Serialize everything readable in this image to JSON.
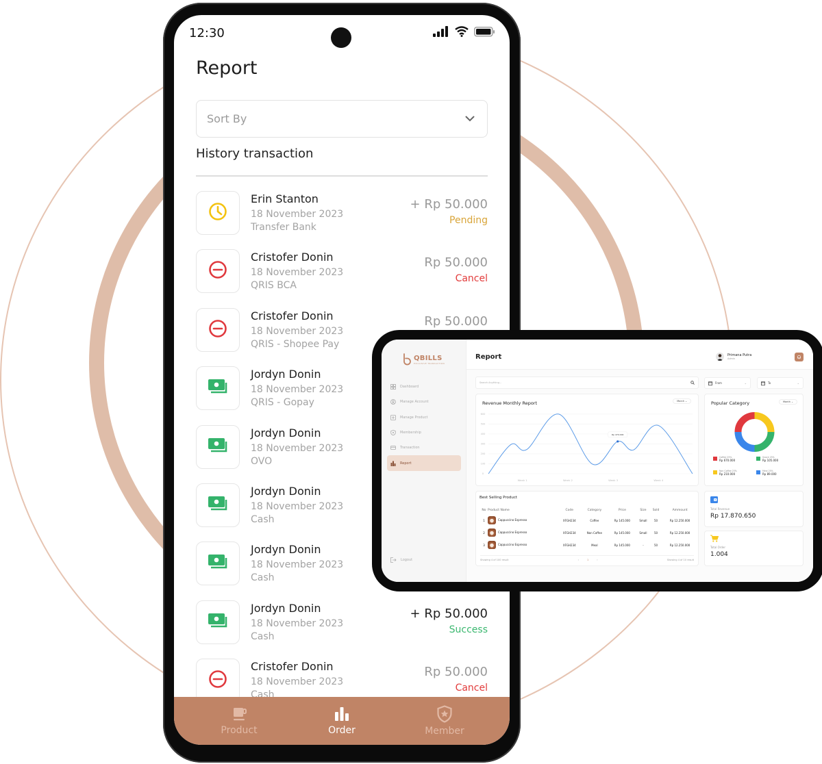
{
  "phone": {
    "status_bar": {
      "time": "12:30"
    },
    "page_title": "Report",
    "sort": {
      "placeholder": "Sort By"
    },
    "section_title": "History transaction",
    "transactions": [
      {
        "name": "Erin Stanton",
        "date": "18 November 2023",
        "method": "Transfer Bank",
        "amount": "+ Rp 50.000",
        "status": "Pending",
        "icon": "clock-icon"
      },
      {
        "name": "Cristofer Donin",
        "date": "18 November 2023",
        "method": "QRIS BCA",
        "amount": "Rp 50.000",
        "status": "Cancel",
        "icon": "minus-circle-icon"
      },
      {
        "name": "Cristofer Donin",
        "date": "18 November 2023",
        "method": "QRIS - Shopee Pay",
        "amount": "Rp 50.000",
        "status": "",
        "icon": "minus-circle-icon"
      },
      {
        "name": "Jordyn Donin",
        "date": "18 November 2023",
        "method": "QRIS - Gopay",
        "amount": "",
        "status": "",
        "icon": "money-icon"
      },
      {
        "name": "Jordyn Donin",
        "date": "18 November 2023",
        "method": "OVO",
        "amount": "",
        "status": "",
        "icon": "money-icon"
      },
      {
        "name": "Jordyn Donin",
        "date": "18 November 2023",
        "method": "Cash",
        "amount": "",
        "status": "",
        "icon": "money-icon"
      },
      {
        "name": "Jordyn Donin",
        "date": "18 November 2023",
        "method": "Cash",
        "amount": "",
        "status": "",
        "icon": "money-icon"
      },
      {
        "name": "Jordyn Donin",
        "date": "18 November 2023",
        "method": "Cash",
        "amount": "+ Rp 50.000",
        "status": "Success",
        "icon": "money-icon"
      },
      {
        "name": "Cristofer Donin",
        "date": "18 November 2023",
        "method": "Cash",
        "amount": "Rp 50.000",
        "status": "Cancel",
        "icon": "minus-circle-icon"
      }
    ],
    "status_colors": {
      "Pending": "#d9a53a",
      "Cancel": "#e23b3b",
      "Success": "#3cb870"
    },
    "bottom_nav": [
      {
        "label": "Product",
        "icon": "cup-icon",
        "active": false
      },
      {
        "label": "Order",
        "icon": "bar-chart-icon",
        "active": true
      },
      {
        "label": "Member",
        "icon": "shield-star-icon",
        "active": false
      }
    ],
    "accent": "#c08466"
  },
  "tablet": {
    "brand": {
      "name": "QBILLS",
      "tagline": "EXCLUSIVE TRANSACTION"
    },
    "sidebar": [
      {
        "label": "Dashboard",
        "icon": "grid-icon"
      },
      {
        "label": "Manage Account",
        "icon": "user-circle-icon"
      },
      {
        "label": "Manage Product",
        "icon": "plus-square-icon"
      },
      {
        "label": "Membership",
        "icon": "shield-star-icon"
      },
      {
        "label": "Transaction",
        "icon": "card-icon"
      },
      {
        "label": "Report",
        "icon": "bar-chart-icon",
        "active": true
      }
    ],
    "logout": "Logout",
    "header": {
      "title": "Report",
      "user_name": "Primana Putra",
      "user_role": "Admin"
    },
    "search": {
      "placeholder": "Search Anything..."
    },
    "from_label": "From",
    "to_label": "To",
    "revenue_card": {
      "title": "Revenue Monthly Report",
      "filter": "March"
    },
    "category_card": {
      "title": "Popular Category",
      "filter": "Month",
      "legend": [
        {
          "label": "Coffee 25%",
          "value": "Rp 670.000",
          "color": "#e0393e"
        },
        {
          "label": "Snack 25%",
          "value": "Rp 105.000",
          "color": "#34b36b"
        },
        {
          "label": "Non Coffee 25%",
          "value": "Rp 210.000",
          "color": "#f7c81e"
        },
        {
          "label": "Meal 25%",
          "value": "Rp 89.000",
          "color": "#3a86ea"
        }
      ]
    },
    "best_selling": {
      "title": "Best Selling Product",
      "columns": [
        "No",
        "Product Name",
        "Code",
        "Category",
        "Price",
        "Size",
        "Sold",
        "Ammount"
      ],
      "rows": [
        [
          "1",
          "Cappuccino Espresso",
          "XFGH234",
          "Coffee",
          "Rp 145.000",
          "Small",
          "50",
          "Rp 12.250.000"
        ],
        [
          "2",
          "Cappuccino Espresso",
          "XFGH234",
          "Non Coffee",
          "Rp 145.000",
          "Small",
          "50",
          "Rp 12.250.000"
        ],
        [
          "3",
          "Cappuccino Espresso",
          "XFGH234",
          "Meal",
          "Rp 145.000",
          "-",
          "50",
          "Rp 12.250.000"
        ]
      ],
      "footer_left": "Showing 4 of 100 result",
      "page": "1",
      "footer_right": "Showing 4 of 10 result"
    },
    "total_revenue": {
      "label": "Total Revenue",
      "value": "Rp 17.870.650"
    },
    "total_order": {
      "label": "Total Order",
      "value": "1.004"
    }
  },
  "chart_data": [
    {
      "type": "line",
      "title": "Revenue Monthly Report",
      "x": [
        0,
        0.5,
        0.85,
        1.55,
        2.3,
        2.85,
        3.2,
        3.75,
        4.5
      ],
      "x_ticks": [
        "Week 1",
        "Week 2",
        "Week 3",
        "Week 4"
      ],
      "values": [
        0,
        295,
        245,
        600,
        95,
        325,
        240,
        485,
        0
      ],
      "y_ticks": [
        0,
        100,
        200,
        300,
        400,
        500,
        600
      ],
      "ylim": [
        0,
        620
      ],
      "tooltip": {
        "text": "Rp 470.000",
        "point_index": 5
      },
      "grid": true,
      "color": "#5b9be8"
    },
    {
      "type": "pie",
      "title": "Popular Category",
      "categories": [
        "Coffee",
        "Non Coffee",
        "Snack",
        "Meal"
      ],
      "values": [
        25,
        25,
        25,
        25
      ],
      "colors": [
        "#e0393e",
        "#f7c81e",
        "#34b36b",
        "#3a86ea"
      ],
      "donut": true
    }
  ]
}
